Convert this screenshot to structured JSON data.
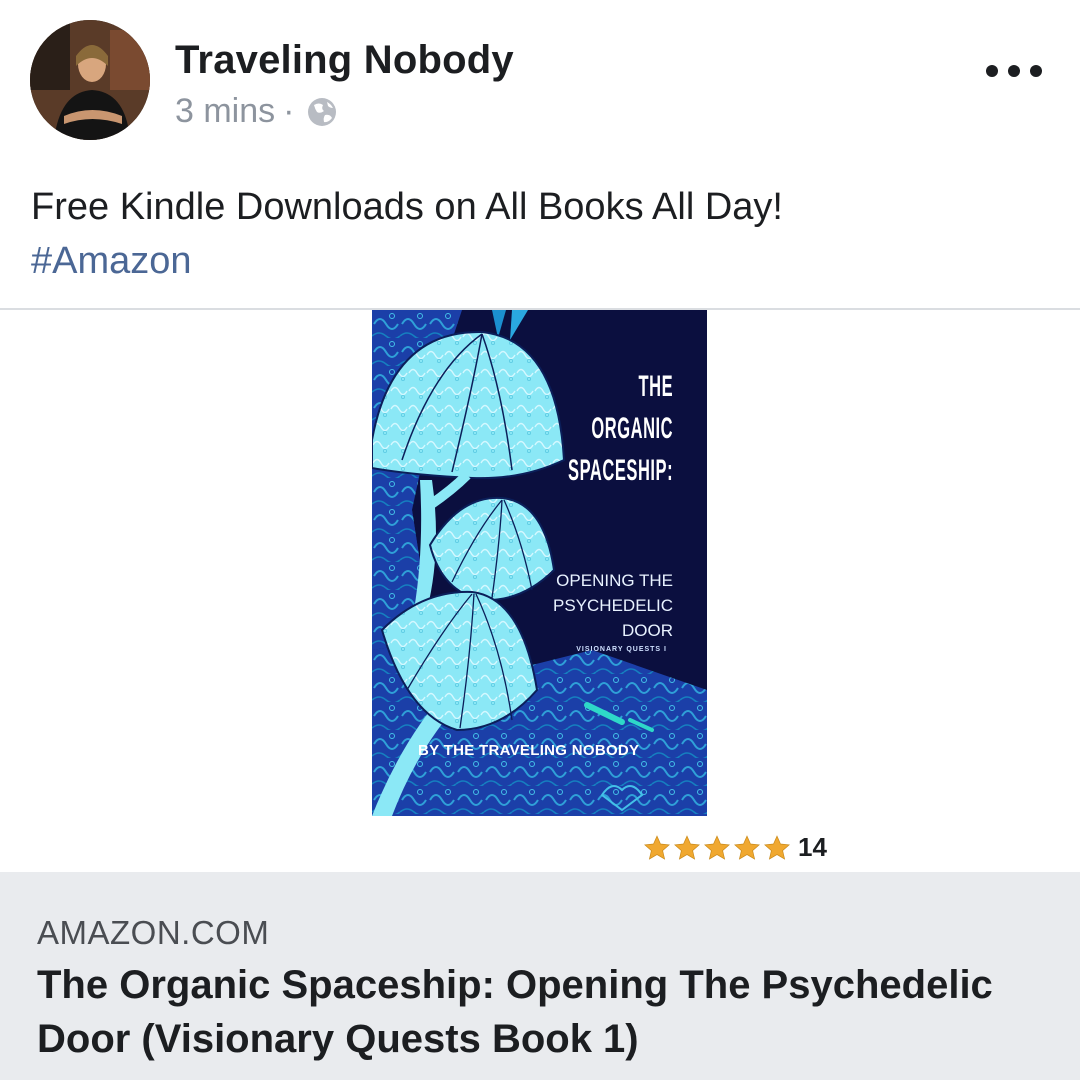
{
  "post": {
    "author_name": "Traveling Nobody",
    "timestamp": "3 mins",
    "separator": "·",
    "privacy_icon": "globe-icon",
    "more_icon": "more-options-icon",
    "text": "Free Kindle Downloads on All Books All Day!",
    "hashtag": "#Amazon"
  },
  "book_cover": {
    "title_line1": "THE",
    "title_line2": "ORGANIC",
    "title_line3": "SPACESHIP:",
    "subtitle_line1": "OPENING THE",
    "subtitle_line2": "PSYCHEDELIC",
    "subtitle_line3": "DOOR",
    "series": "VISIONARY QUESTS I",
    "author": "BY THE TRAVELING NOBODY"
  },
  "rating": {
    "stars": 5,
    "max_stars": 5,
    "count": "14",
    "star_color": "#f0a830"
  },
  "link_preview": {
    "domain": "AMAZON.COM",
    "title": "The Organic Spaceship: Opening The Psychedelic Door (Visionary Quests Book 1)"
  },
  "colors": {
    "hashtag": "#4b6795",
    "meta_gray": "#8d949e",
    "card_background": "#e9ebee",
    "cover_navy": "#0b0f3f",
    "cover_blue": "#1e4ab8",
    "mushroom_cyan": "#7ee6f5"
  }
}
